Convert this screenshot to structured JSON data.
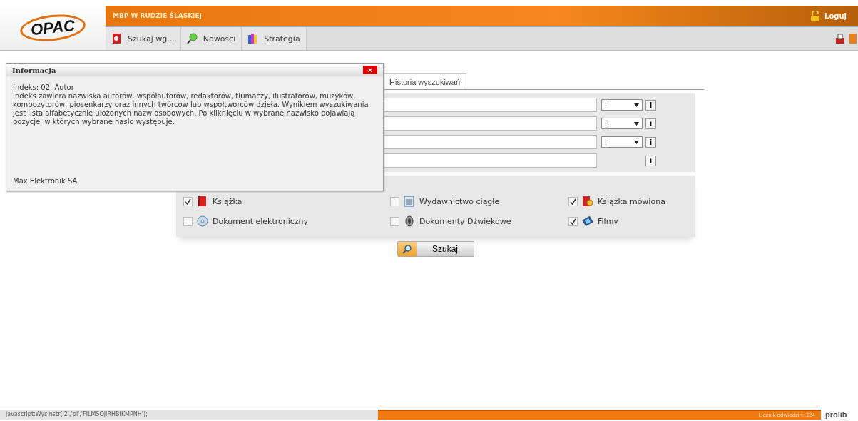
{
  "header": {
    "library": "MBP W RUDZIE ŚLĄSKIEJ",
    "logo": "OPAC",
    "login": "Loguj"
  },
  "nav": [
    {
      "label": "Szukaj wg..."
    },
    {
      "label": "Nowości"
    },
    {
      "label": "Strategia"
    }
  ],
  "tabs": [
    {
      "label": "Historia wyszukiwań",
      "selected": false
    }
  ],
  "search_rows": [
    {
      "operator": "i",
      "info": "i"
    },
    {
      "operator": "i",
      "info": "i"
    },
    {
      "operator": "i",
      "info": "i"
    },
    {
      "info": "i"
    }
  ],
  "materials": [
    {
      "label": "Książka",
      "checked": true
    },
    {
      "label": "Wydawnictwo ciągłe",
      "checked": false
    },
    {
      "label": "Książka mówiona",
      "checked": true
    },
    {
      "label": "Dokument elektroniczny",
      "checked": false
    },
    {
      "label": "Dokumenty Dźwiękowe",
      "checked": false
    },
    {
      "label": "Filmy",
      "checked": true
    }
  ],
  "search_button": "Szukaj",
  "dialog": {
    "title": "Informacja",
    "close": "×",
    "heading": "Indeks: 02. Autor",
    "body": "Indeks zawiera nazwiska autorów, współautorów, redaktorów, tłumaczy, ilustratorów, muzyków, kompozytorów, piosenkarzy oraz innych twórców lub współtwórców dzieła. Wynikiem wyszukiwania jest lista alfabetycznie ułożonych nazw osobowych. Po kliknięciu w wybrane nazwisko pojawiają pozycje, w których wybrane haslo występuje.",
    "footer": "Max Elektronik SA"
  },
  "status_bar": {
    "text": "javascript:WysInstr('2','pl','FILMSOJIRHBIKMPNH');",
    "counter": "Licznik odwiedzin: 324",
    "logo": "prolib"
  }
}
